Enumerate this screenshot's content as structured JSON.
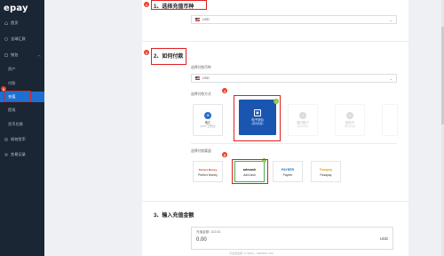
{
  "app": {
    "logo": "epay"
  },
  "sidebar": {
    "items": [
      {
        "label": "首页"
      },
      {
        "label": "全球汇款"
      },
      {
        "label": "钱包"
      },
      {
        "label": "资产"
      },
      {
        "label": "付款"
      },
      {
        "label": "充值"
      },
      {
        "label": "提现"
      },
      {
        "label": "货币兑换"
      },
      {
        "label": "如何货币"
      },
      {
        "label": "交易记录"
      }
    ]
  },
  "steps": {
    "step1": {
      "number": "1",
      "title": "1、选择充值币种",
      "currency": "USD"
    },
    "step2": {
      "number": "2",
      "title": "2、如何付款",
      "currency_label": "选择付款币种",
      "currency": "USD",
      "method_label": "选择付款方式",
      "method_badge": "4",
      "methods": [
        {
          "title": "电汇",
          "sub": "(1-5个工作日)"
        },
        {
          "title": "电子钱包",
          "sub": "(即时到账)"
        },
        {
          "title": "银行账户",
          "sub": "(即时到账)"
        },
        {
          "title": "信用卡",
          "sub": "(即时到账)"
        }
      ],
      "channel_label": "选择付款渠道",
      "channel_badge": "5",
      "channels": [
        {
          "logo": "Perfect Money",
          "name": "Perfect Money"
        },
        {
          "logo": "advcash",
          "name": "AdvCash"
        },
        {
          "logo": "PAYEER",
          "name": "Payeer"
        },
        {
          "logo": "Fasapay",
          "name": "Fasapay"
        }
      ]
    },
    "step3": {
      "number": "3",
      "title": "3、输入充值金额",
      "balance_label": "充值金额: 102.63",
      "amount": "0.00",
      "currency": "USD",
      "hint": "可充值金额: 0.70000 ~ 9999999 USD"
    }
  },
  "sidebar_badge": "3",
  "colors": {
    "sidebar": "#1b2634",
    "accent": "#1f6fd1",
    "highlight": "#e02020",
    "check": "#8bc34a"
  }
}
